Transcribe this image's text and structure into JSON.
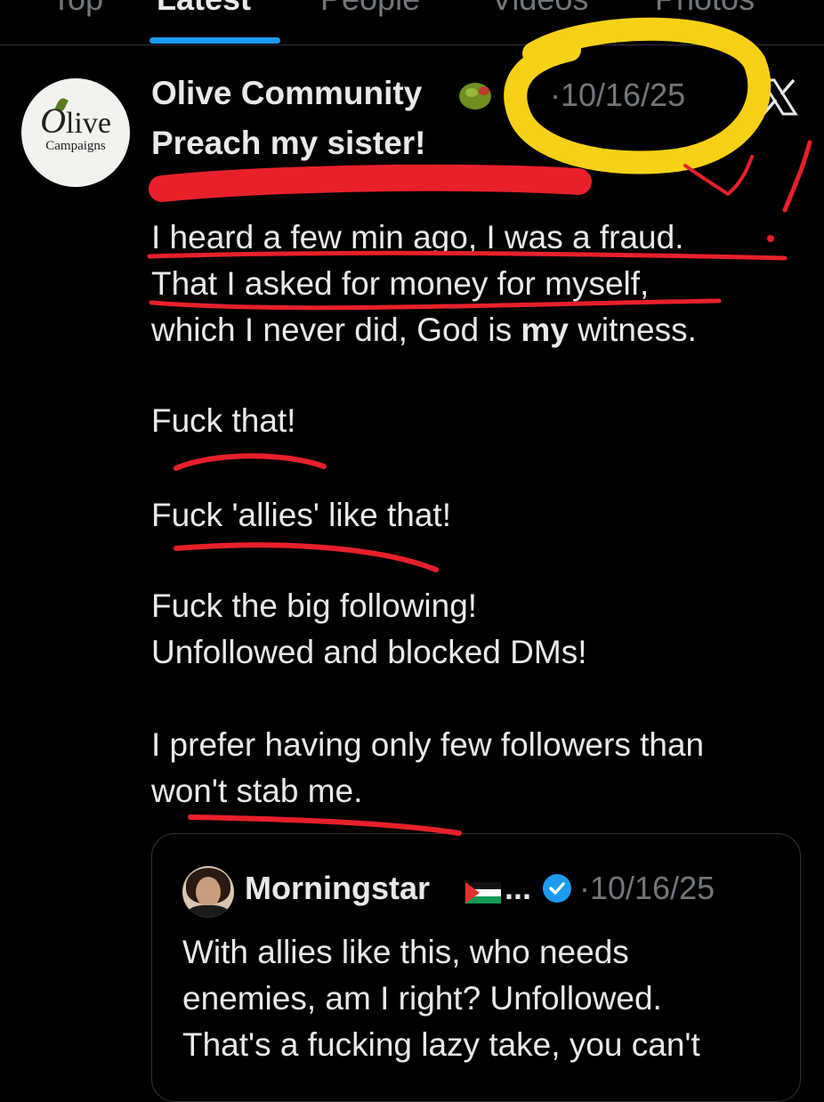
{
  "tabs": [
    {
      "label": "Top",
      "active": false
    },
    {
      "label": "Latest",
      "active": true
    },
    {
      "label": "People",
      "active": false
    },
    {
      "label": "Videos",
      "active": false
    },
    {
      "label": "Photos",
      "active": false
    }
  ],
  "post": {
    "avatar": {
      "logo_main": "live",
      "logo_initial": "O",
      "logo_sub": "Campaigns"
    },
    "author": "Olive Community",
    "author_emoji": "olive-emoji",
    "timestamp": "·10/16/25",
    "platform_icon": "x-logo-icon",
    "headline": "Preach my sister!",
    "lines": [
      "I heard a few min ago, I was a fraud.",
      "That I asked for money for myself,",
      "which I never did, God is",
      "my",
      "witness.",
      "Fuck that!",
      "Fuck 'allies' like that!",
      "Fuck the big following!",
      "Unfollowed and blocked DMs!",
      "I prefer having only few followers than",
      "won't stab me."
    ]
  },
  "quote": {
    "author": "Morningstar",
    "flag_icon": "palestine-flag-icon",
    "ellipsis": "...",
    "verified_icon": "verified-badge-icon",
    "timestamp": "·10/16/25",
    "lines": [
      "With allies like this, who needs",
      "enemies, am I right? Unfollowed.",
      "That's a fucking lazy take, you can't"
    ]
  },
  "colors": {
    "background": "#000000",
    "text": "#e7e9ea",
    "muted": "#71767b",
    "accent": "#1d9bf0",
    "annotation_red": "#e8202a",
    "annotation_yellow": "#f7d117"
  }
}
